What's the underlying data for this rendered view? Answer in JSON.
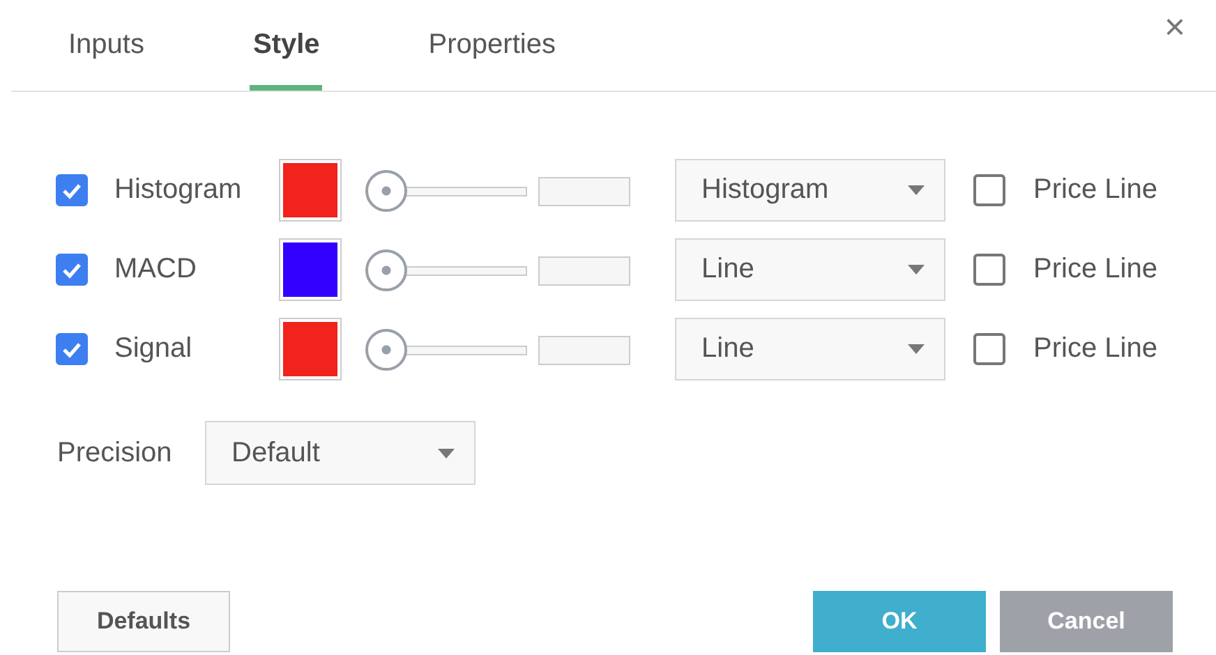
{
  "tabs": [
    {
      "label": "Inputs",
      "selected": false
    },
    {
      "label": "Style",
      "selected": true
    },
    {
      "label": "Properties",
      "selected": false
    }
  ],
  "close": "×",
  "plots": [
    {
      "name": "Histogram",
      "checked": true,
      "color": "#f2221c",
      "level": 0,
      "style": "Histogram",
      "price_line": "Price Line",
      "price_line_checked": false
    },
    {
      "name": "MACD",
      "checked": true,
      "color": "#3300ff",
      "level": 0,
      "style": "Line",
      "price_line": "Price Line",
      "price_line_checked": false
    },
    {
      "name": "Signal",
      "checked": true,
      "color": "#f2221c",
      "level": 0,
      "style": "Line",
      "price_line": "Price Line",
      "price_line_checked": false
    }
  ],
  "precision": {
    "label": "Precision",
    "value": "Default"
  },
  "buttons": [
    {
      "label": "Defaults",
      "kind": "secondary"
    },
    {
      "label": "OK",
      "kind": "primary"
    },
    {
      "label": "Cancel",
      "kind": "cancel"
    }
  ]
}
